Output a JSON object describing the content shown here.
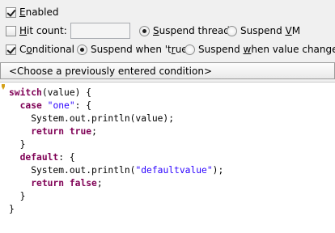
{
  "options": {
    "enabled": {
      "prefix": "",
      "mnemonic": "E",
      "suffix": "nabled",
      "checked": true
    },
    "hit_count": {
      "prefix": "",
      "mnemonic": "H",
      "suffix": "it count:",
      "checked": false,
      "value": ""
    },
    "suspend_thread": {
      "prefix": "",
      "mnemonic": "S",
      "suffix": "uspend thread",
      "selected": true
    },
    "suspend_vm": {
      "prefix": "Suspend ",
      "mnemonic": "V",
      "suffix": "M",
      "selected": false
    },
    "conditional": {
      "prefix": "C",
      "mnemonic": "o",
      "suffix": "nditional",
      "checked": true
    },
    "suspend_true": {
      "prefix": "Suspend when 't",
      "mnemonic": "r",
      "suffix": "ue'",
      "selected": true
    },
    "suspend_changes": {
      "prefix": "Suspend ",
      "mnemonic": "w",
      "suffix": "hen value changes",
      "selected": false
    }
  },
  "condition_combo": {
    "value": "<Choose a previously entered condition>"
  },
  "editor": {
    "lines": [
      "switch(value) {",
      "  case \"one\": {",
      "    System.out.println(value);",
      "    return true;",
      "  }",
      "  default: {",
      "    System.out.println(\"defaultvalue\");",
      "    return false;",
      "  }",
      "}"
    ],
    "keywords": [
      "switch",
      "case",
      "return",
      "true",
      "false",
      "default"
    ],
    "colors": {
      "keyword": "#7f0055",
      "string": "#2a00ff",
      "marker": "#d4a017"
    }
  }
}
